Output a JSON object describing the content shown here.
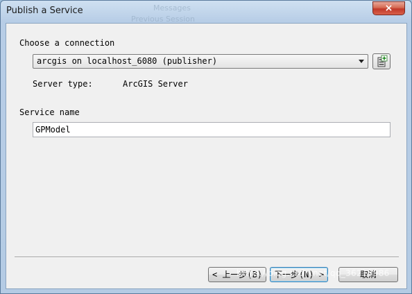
{
  "window": {
    "title": "Publish a Service",
    "close_glyph": "×",
    "background_ghost": {
      "line1": "Messages",
      "line2": "Previous Session"
    }
  },
  "connection": {
    "section_label": "Choose a connection",
    "selected": "arcgis on localhost_6080 (publisher)",
    "add_connection_icon": "add-server-connection-icon",
    "server_type_label": "Server type:",
    "server_type_value": "ArcGIS Server"
  },
  "service": {
    "name_label": "Service name",
    "name_value": "GPModel"
  },
  "footer": {
    "back_label": "< 上一步(B)",
    "next_label": "下一步(N) >",
    "cancel_label": "取消"
  },
  "watermark": "https://blog.csdn.net/qq_36213986",
  "colors": {
    "close_button": "#c1392a",
    "title_bar": "#b9cfe7",
    "client_bg": "#f0f0f0",
    "default_button_border": "#3c7fb1"
  }
}
